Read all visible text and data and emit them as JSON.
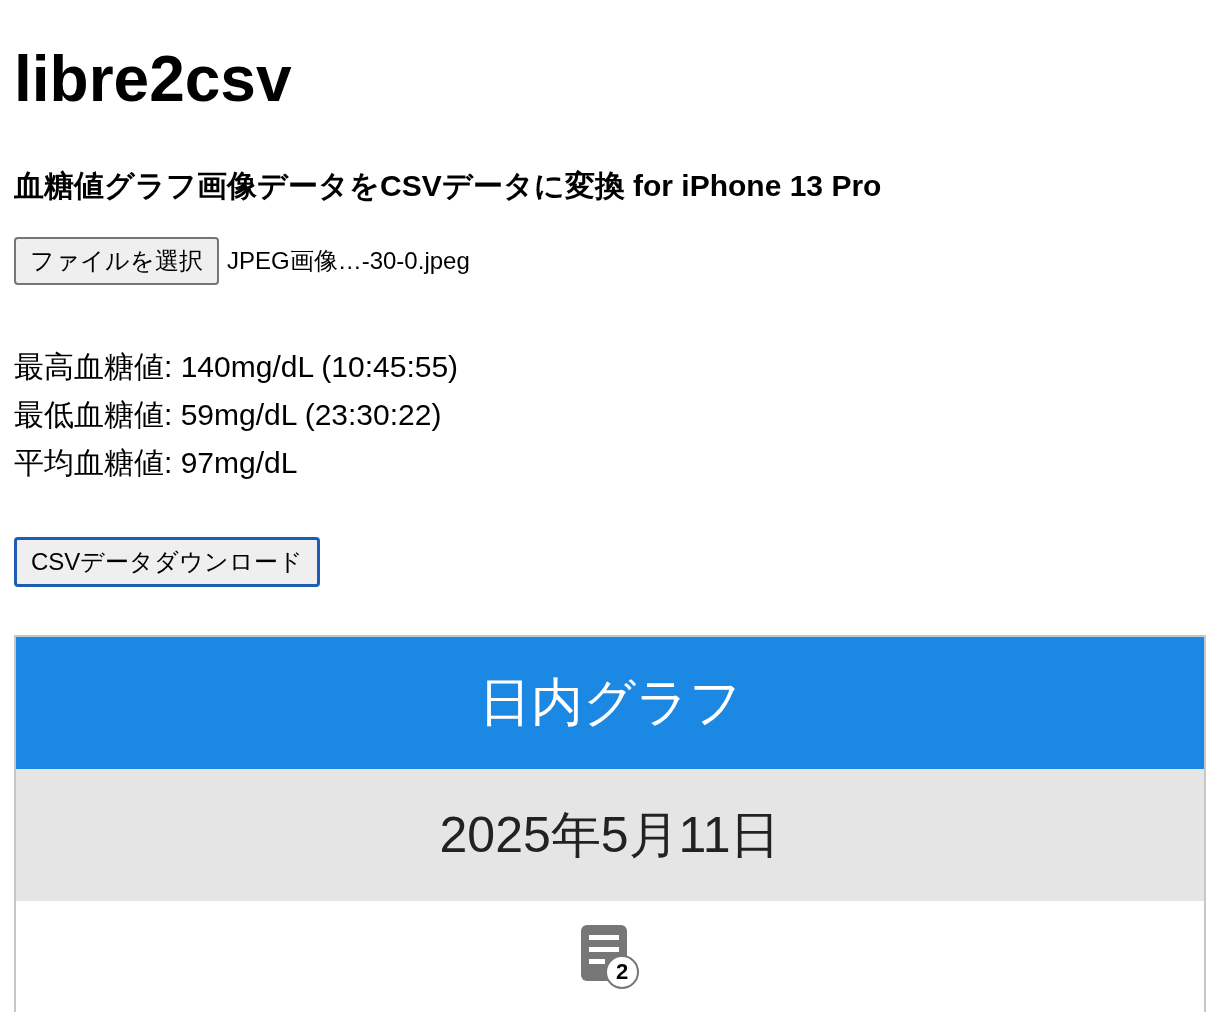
{
  "title": "libre2csv",
  "subtitle": "血糖値グラフ画像データをCSVデータに変換 for iPhone 13 Pro",
  "file_picker": {
    "button": "ファイルを選択",
    "file_name": "JPEG画像…-30-0.jpeg"
  },
  "stats": [
    "最高血糖値: 140mg/dL (10:45:55)",
    "最低血糖値: 59mg/dL (23:30:22)",
    "平均血糖値: 97mg/dL"
  ],
  "download_button": {
    "label": "CSVデータダウンロード",
    "focused": true
  },
  "graph_image": {
    "header": "日内グラフ",
    "date": "2025年5月11日",
    "notes_badge": "2"
  }
}
